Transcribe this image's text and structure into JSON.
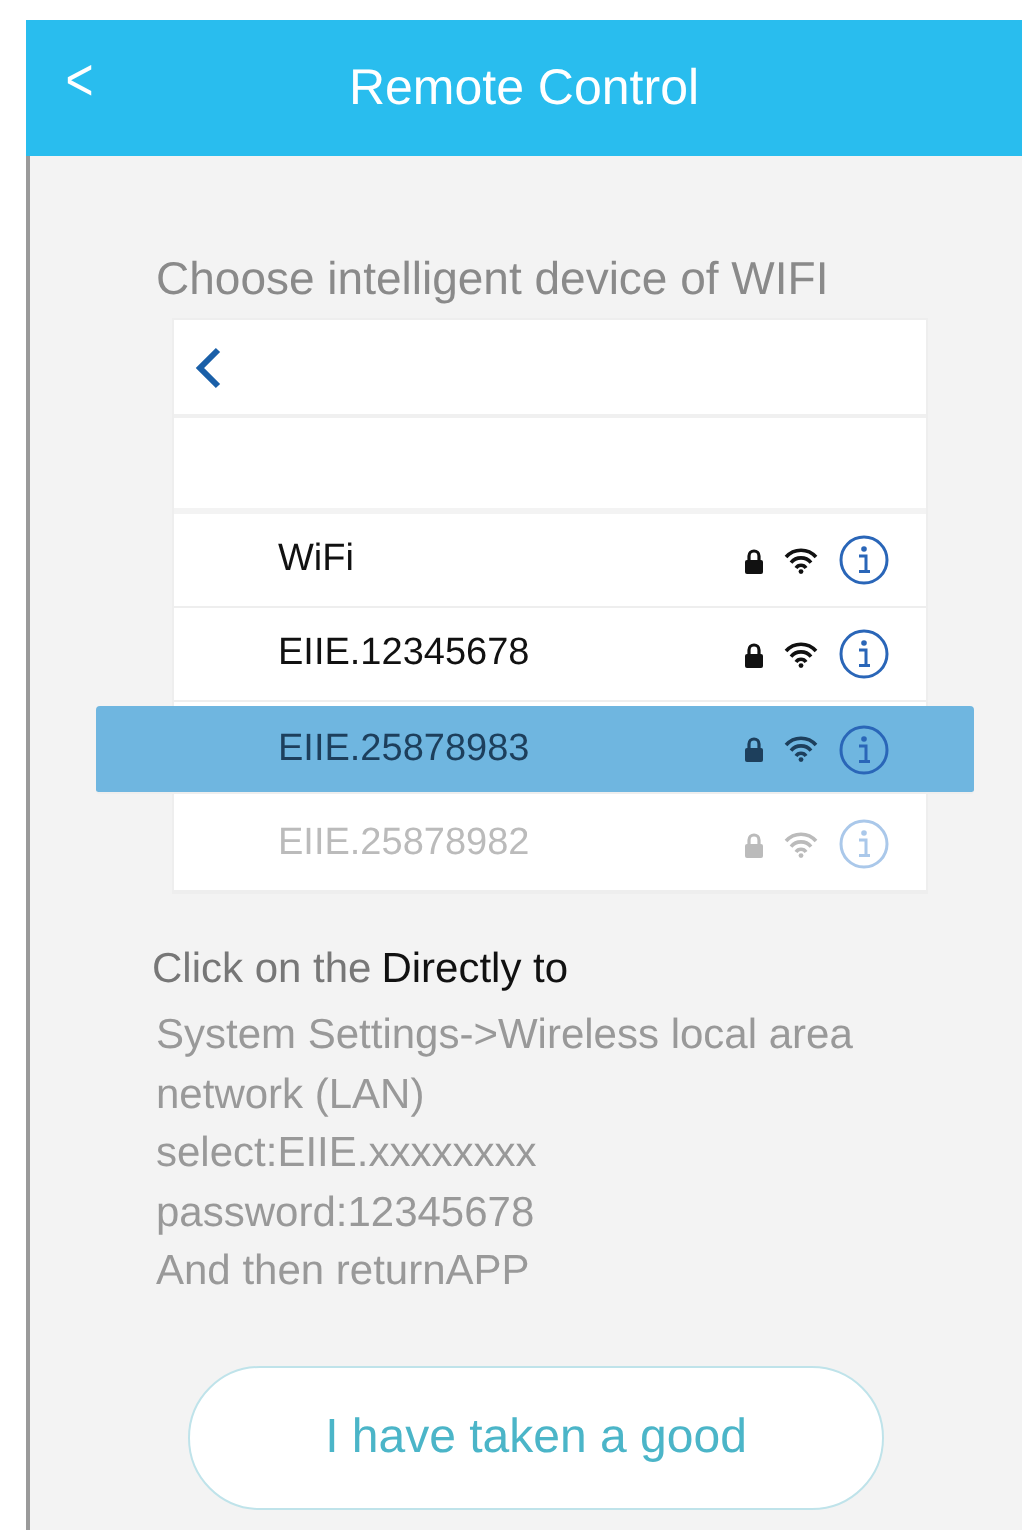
{
  "header": {
    "back": "<",
    "title": "Remote Control"
  },
  "prompt": "Choose intelligent device of WIFI",
  "networks": [
    {
      "name": "WiFi",
      "selected": false,
      "dimmed": false
    },
    {
      "name": "EIIE.12345678",
      "selected": false,
      "dimmed": false
    },
    {
      "name": "EIIE.25878983",
      "selected": true,
      "dimmed": false
    },
    {
      "name": "EIIE.25878982",
      "selected": false,
      "dimmed": true
    }
  ],
  "instruction_head": [
    "Click on the",
    "Directly to"
  ],
  "instruction_lines": [
    "System Settings->Wireless local area",
    "network (LAN)",
    "select:EIIE.xxxxxxxx",
    "password:12345678",
    "And then returnAPP"
  ],
  "button": "I have taken a good"
}
